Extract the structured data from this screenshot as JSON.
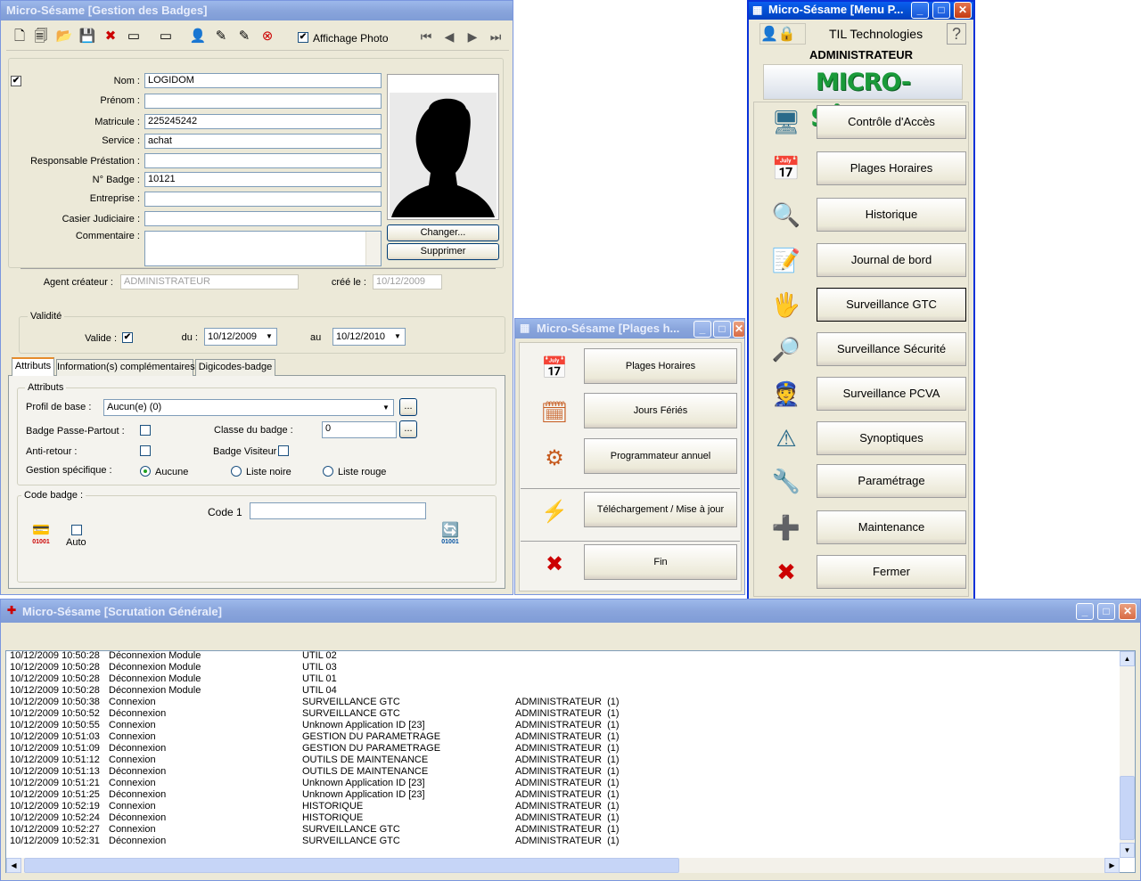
{
  "badge_window": {
    "title": "Micro-Sésame [Gestion des Badges]",
    "affichage_photo_label": "Affichage Photo",
    "toolbar_icons": [
      "new-doc-icon",
      "copy-doc-icon",
      "open-folder-icon",
      "save-icon",
      "delete-icon",
      "badge-icon",
      "badges-icon",
      "user-card-icon",
      "wand-icon",
      "edit-icon",
      "cancel-icon"
    ],
    "nav_icons": [
      "first-record-icon",
      "prev-record-icon",
      "next-record-icon",
      "last-record-icon"
    ],
    "fields": {
      "nom_label": "Nom :",
      "nom_value": "LOGIDOM",
      "prenom_label": "Prénom :",
      "prenom_value": "",
      "matricule_label": "Matricule :",
      "matricule_value": "225245242",
      "service_label": "Service :",
      "service_value": "achat",
      "resp_label": "Responsable Préstation :",
      "resp_value": "",
      "badge_label": "N° Badge :",
      "badge_value": "10121",
      "entreprise_label": "Entreprise :",
      "entreprise_value": "",
      "casier_label": "Casier Judiciaire :",
      "casier_value": "",
      "commentaire_label": "Commentaire :",
      "commentaire_value": ""
    },
    "photo_buttons": {
      "change": "Changer...",
      "delete": "Supprimer"
    },
    "agent_label": "Agent créateur :",
    "agent_value": "ADMINISTRATEUR",
    "cree_label": "créé le :",
    "cree_value": "10/12/2009",
    "validite": {
      "title": "Validité",
      "valide_label": "Valide :",
      "du_label": "du :",
      "du_value": "10/12/2009",
      "au_label": "au",
      "au_value": "10/12/2010"
    },
    "tabs": [
      "Attributs",
      "Information(s) complémentaires",
      "Digicodes-badge"
    ],
    "attributs": {
      "title": "Attributs",
      "profil_label": "Profil de base :",
      "profil_value": "Aucun(e) (0)",
      "passe_label": "Badge Passe-Partout :",
      "classe_label": "Classe du badge :",
      "classe_value": "0",
      "antiretour_label": "Anti-retour :",
      "visiteur_label": "Badge Visiteur",
      "gestion_label": "Gestion spécifique :",
      "radio_aucune": "Aucune",
      "radio_noire": "Liste noire",
      "radio_rouge": "Liste rouge",
      "ellipsis": "..."
    },
    "code": {
      "title": "Code badge :",
      "code1_label": "Code 1",
      "code1_value": "",
      "auto_label": "Auto",
      "chip_text": "01001"
    }
  },
  "menu_window": {
    "title": "Micro-Sésame [Menu P...",
    "company": "TIL Technologies",
    "user": "ADMINISTRATEUR",
    "logo_text": "MICRO-SÉSAME",
    "help": "?",
    "items": [
      {
        "label": "Contrôle d'Accès",
        "icon": "access-control-icon",
        "glyph": "🖥"
      },
      {
        "label": "Plages Horaires",
        "icon": "calendar-clock-icon",
        "glyph": "📅"
      },
      {
        "label": "Historique",
        "icon": "history-search-icon",
        "glyph": "🔍"
      },
      {
        "label": "Journal de bord",
        "icon": "logbook-icon",
        "glyph": "📝"
      },
      {
        "label": "Surveillance GTC",
        "icon": "gtc-monitor-icon",
        "glyph": "🖐"
      },
      {
        "label": "Surveillance Sécurité",
        "icon": "security-monitor-icon",
        "glyph": "🔎"
      },
      {
        "label": "Surveillance PCVA",
        "icon": "pcva-guard-icon",
        "glyph": "👮"
      },
      {
        "label": "Synoptiques",
        "icon": "synoptic-warning-icon",
        "glyph": "⚠"
      },
      {
        "label": "Paramétrage",
        "icon": "settings-tools-icon",
        "glyph": "🔧"
      },
      {
        "label": "Maintenance",
        "icon": "medical-kit-icon",
        "glyph": "➕"
      },
      {
        "label": "Fermer",
        "icon": "close-circle-icon",
        "glyph": "✖"
      }
    ]
  },
  "plages_window": {
    "title": "Micro-Sésame [Plages h...",
    "items": [
      {
        "label": "Plages Horaires",
        "icon": "calendar-clock-icon",
        "glyph": "📅"
      },
      {
        "label": "Jours Fériés",
        "icon": "holiday-calendar-icon",
        "glyph": "🗓"
      },
      {
        "label": "Programmateur annuel",
        "icon": "calendar-gear-icon",
        "glyph": "⚙"
      },
      {
        "label": "Téléchargement / Mise à jour",
        "icon": "lightning-icon",
        "glyph": "⚡"
      },
      {
        "label": "Fin",
        "icon": "close-circle-icon",
        "glyph": "✖"
      }
    ]
  },
  "scan_window": {
    "title": "Micro-Sésame [Scrutation Générale]",
    "rows": [
      {
        "time": "10/12/2009 10:50:28",
        "event": "Déconnexion Module",
        "target": "UTIL 02",
        "user": ""
      },
      {
        "time": "10/12/2009 10:50:28",
        "event": "Déconnexion Module",
        "target": "UTIL 03",
        "user": ""
      },
      {
        "time": "10/12/2009 10:50:28",
        "event": "Déconnexion Module",
        "target": "UTIL 01",
        "user": ""
      },
      {
        "time": "10/12/2009 10:50:28",
        "event": "Déconnexion Module",
        "target": "UTIL 04",
        "user": ""
      },
      {
        "time": "10/12/2009 10:50:38",
        "event": "Connexion",
        "target": "SURVEILLANCE GTC",
        "user": "ADMINISTRATEUR  (1)"
      },
      {
        "time": "10/12/2009 10:50:52",
        "event": "Déconnexion",
        "target": "SURVEILLANCE GTC",
        "user": "ADMINISTRATEUR  (1)"
      },
      {
        "time": "10/12/2009 10:50:55",
        "event": "Connexion",
        "target": "Unknown Application ID [23]",
        "user": "ADMINISTRATEUR  (1)"
      },
      {
        "time": "10/12/2009 10:51:03",
        "event": "Connexion",
        "target": "GESTION DU PARAMETRAGE",
        "user": "ADMINISTRATEUR  (1)"
      },
      {
        "time": "10/12/2009 10:51:09",
        "event": "Déconnexion",
        "target": "GESTION DU PARAMETRAGE",
        "user": "ADMINISTRATEUR  (1)"
      },
      {
        "time": "10/12/2009 10:51:12",
        "event": "Connexion",
        "target": "OUTILS DE MAINTENANCE",
        "user": "ADMINISTRATEUR  (1)"
      },
      {
        "time": "10/12/2009 10:51:13",
        "event": "Déconnexion",
        "target": "OUTILS DE MAINTENANCE",
        "user": "ADMINISTRATEUR  (1)"
      },
      {
        "time": "10/12/2009 10:51:21",
        "event": "Connexion",
        "target": "Unknown Application ID [23]",
        "user": "ADMINISTRATEUR  (1)"
      },
      {
        "time": "10/12/2009 10:51:25",
        "event": "Déconnexion",
        "target": "Unknown Application ID [23]",
        "user": "ADMINISTRATEUR  (1)"
      },
      {
        "time": "10/12/2009 10:52:19",
        "event": "Connexion",
        "target": "HISTORIQUE",
        "user": "ADMINISTRATEUR  (1)"
      },
      {
        "time": "10/12/2009 10:52:24",
        "event": "Déconnexion",
        "target": "HISTORIQUE",
        "user": "ADMINISTRATEUR  (1)"
      },
      {
        "time": "10/12/2009 10:52:27",
        "event": "Connexion",
        "target": "SURVEILLANCE GTC",
        "user": "ADMINISTRATEUR  (1)"
      },
      {
        "time": "10/12/2009 10:52:31",
        "event": "Déconnexion",
        "target": "SURVEILLANCE GTC",
        "user": "ADMINISTRATEUR  (1)"
      }
    ]
  },
  "colors": {
    "title_active": "#0553d8",
    "title_inactive": "#8aa5dc",
    "window_bg": "#ece9d8",
    "logo_green": "#1a9a3a"
  }
}
